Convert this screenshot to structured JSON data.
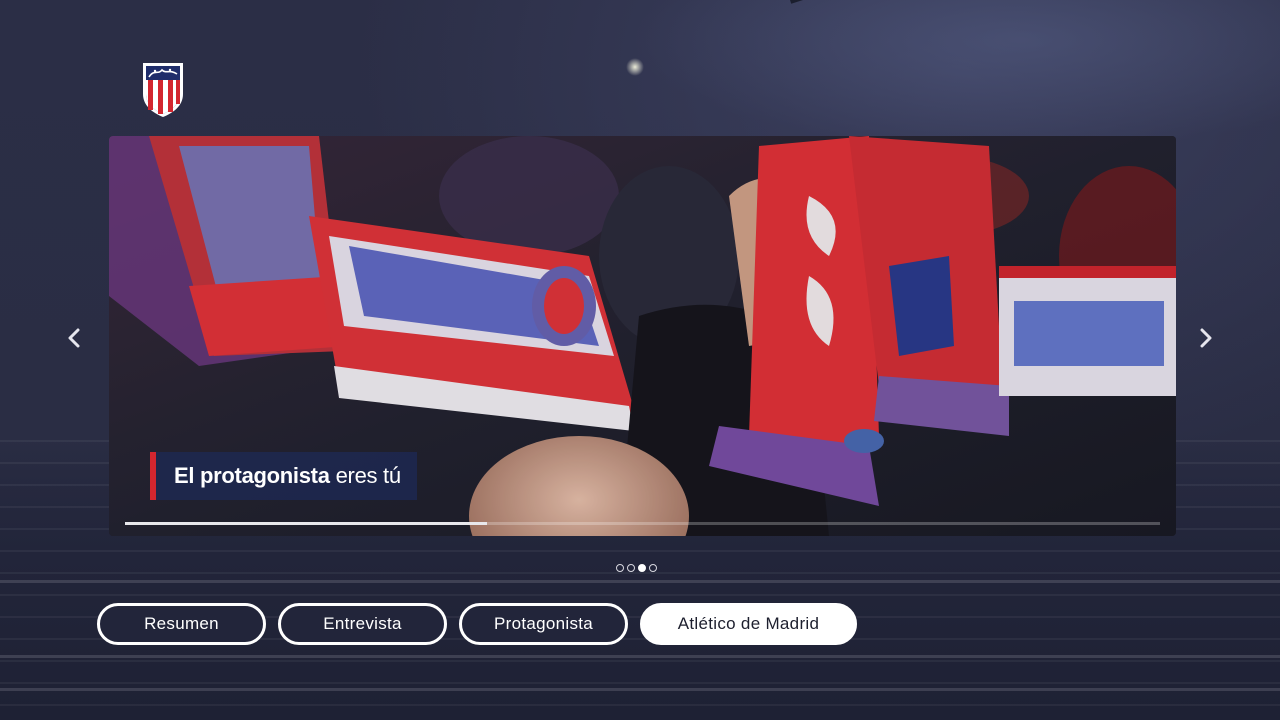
{
  "carousel": {
    "caption_bold": "El protagonista",
    "caption_rest": "eres tú",
    "progress": 0.35,
    "dots": [
      {
        "active": false
      },
      {
        "active": false
      },
      {
        "active": true
      },
      {
        "active": false
      }
    ]
  },
  "tabs": [
    {
      "label": "Resumen",
      "selected": false
    },
    {
      "label": "Entrevista",
      "selected": false
    },
    {
      "label": "Protagonista",
      "selected": false
    },
    {
      "label": "Atlético de Madrid",
      "selected": true
    }
  ],
  "icons": {
    "logo": "atletico-madrid-crest-icon",
    "prev": "chevron-left-icon",
    "next": "chevron-right-icon"
  },
  "colors": {
    "accent_red": "#d3262f",
    "background": "#2a2d44",
    "caption_bg": "#1e2850"
  }
}
